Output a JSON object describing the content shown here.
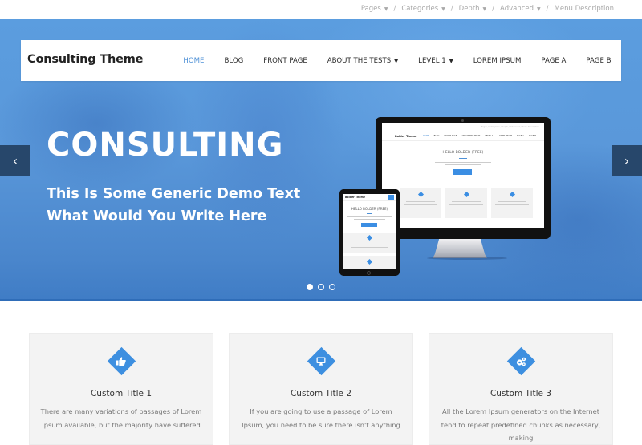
{
  "top_menu": {
    "items": [
      {
        "label": "Pages",
        "has_dropdown": true
      },
      {
        "label": "Categories",
        "has_dropdown": true
      },
      {
        "label": "Depth",
        "has_dropdown": true
      },
      {
        "label": "Advanced",
        "has_dropdown": true
      },
      {
        "label": "Menu Description",
        "has_dropdown": false
      }
    ],
    "separator": "/",
    "caret": "▼"
  },
  "header": {
    "brand": "Consulting Theme",
    "nav": [
      {
        "label": "HOME",
        "active": true
      },
      {
        "label": "BLOG"
      },
      {
        "label": "FRONT PAGE"
      },
      {
        "label": "ABOUT THE TESTS",
        "has_dropdown": true
      },
      {
        "label": "LEVEL 1",
        "has_dropdown": true
      },
      {
        "label": "LOREM IPSUM"
      },
      {
        "label": "PAGE A"
      },
      {
        "label": "PAGE B"
      }
    ],
    "caret": "▼",
    "accent_color": "#4d90d6"
  },
  "hero": {
    "title": "CONSULTING",
    "subtitle_line1": "This Is Some Generic Demo Text",
    "subtitle_line2": "What Would You Write Here",
    "prev_label": "‹",
    "next_label": "›",
    "slides": 3,
    "active_slide": 1,
    "arrow_color": "#27476b",
    "mockup": {
      "brand": "Bolder Theme",
      "headline": "HELLO BOLDER (FREE)",
      "nav": [
        "HOME",
        "BLOG",
        "FRONT PAGE",
        "ABOUT THE TESTS",
        "LEVEL 1",
        "LOREM IPSUM",
        "PAGE A",
        "PAGE B"
      ],
      "top_links": "Pages / Categories / Depth / Advanced / Menu Description"
    }
  },
  "features": {
    "accent_color": "#3d8fe0",
    "cards": [
      {
        "icon": "thumbs-up-icon",
        "glyph": "👍",
        "title": "Custom Title 1",
        "desc": "There are many variations of passages of Lorem Ipsum available, but the majority have suffered"
      },
      {
        "icon": "monitor-icon",
        "glyph": "🖥",
        "title": "Custom Title 2",
        "desc": "If you are going to use a passage of Lorem Ipsum, you need to be sure there isn't anything"
      },
      {
        "icon": "cogs-icon",
        "glyph": "⚙",
        "title": "Custom Title 3",
        "desc": "All the Lorem Ipsum generators on the Internet tend to repeat predefined chunks as necessary, making"
      }
    ]
  }
}
